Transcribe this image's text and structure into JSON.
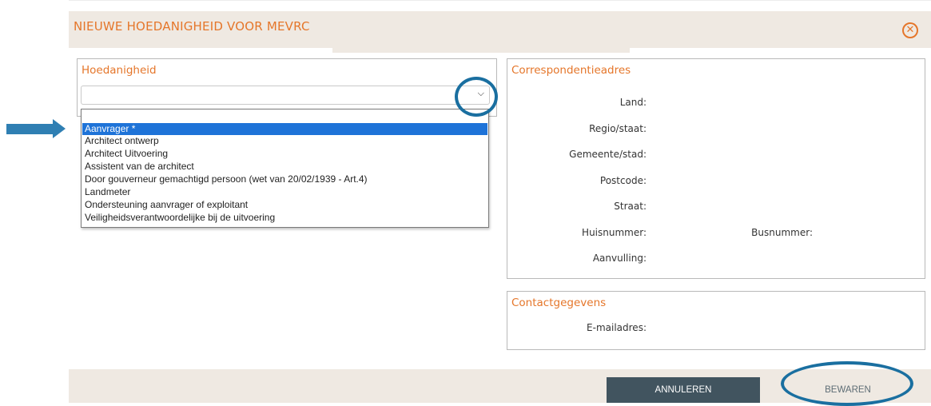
{
  "header": {
    "title": "NIEUWE HOEDANIGHEID VOOR MEVRC",
    "close_icon": "close-circle-icon"
  },
  "hoedanigheid": {
    "title": "Hoedanigheid",
    "select_value": "",
    "options": [
      "Aanvrager *",
      "Architect ontwerp",
      "Architect Uitvoering",
      "Assistent van de architect",
      "Door gouverneur gemachtigd persoon (wet van 20/02/1939 - Art.4)",
      "Landmeter",
      "Ondersteuning aanvrager of exploitant",
      "Veiligheidsverantwoordelijke bij de uitvoering"
    ],
    "highlighted_option": "Aanvrager *"
  },
  "correspondentie": {
    "title": "Correspondentieadres",
    "land": "Land:",
    "regio": "Regio/staat:",
    "gemeente": "Gemeente/stad:",
    "postcode": "Postcode:",
    "straat": "Straat:",
    "huisnummer": "Huisnummer:",
    "busnummer": "Busnummer:",
    "aanvulling": "Aanvulling:"
  },
  "contact": {
    "title": "Contactgegevens",
    "email": "E-mailadres:"
  },
  "footer": {
    "cancel_label": "ANNULEREN",
    "save_label": "BEWAREN"
  },
  "annotations": {
    "color": "#1a6fa0",
    "pointer_icon": "arrow-right-icon"
  },
  "colors": {
    "accent": "#e5762a",
    "header_bg": "#efe9e2",
    "selected_option_bg": "#1e73d8",
    "cancel_button_bg": "#41545f"
  }
}
